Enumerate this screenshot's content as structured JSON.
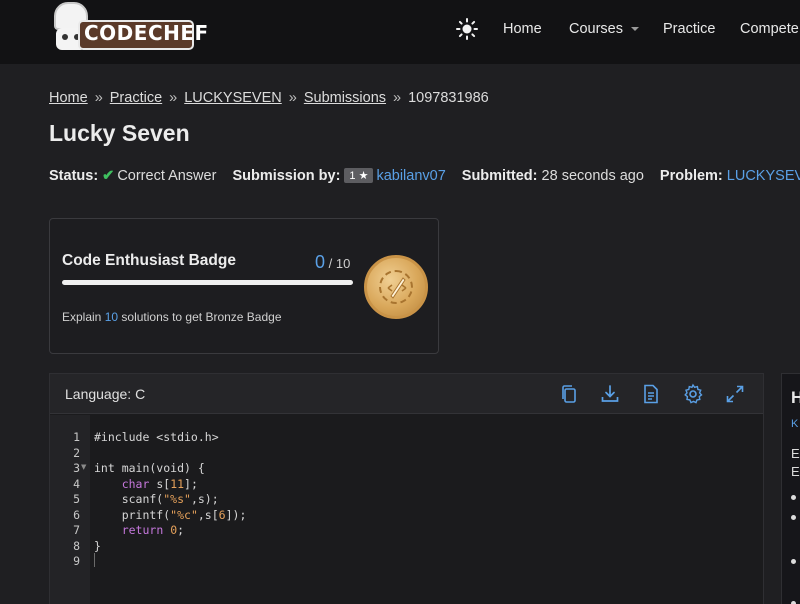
{
  "brand": {
    "logo_text": "CODECHEF"
  },
  "nav": {
    "home": "Home",
    "courses": "Courses",
    "practice": "Practice",
    "compete": "Compete"
  },
  "breadcrumb": {
    "home": "Home",
    "practice": "Practice",
    "problem": "LUCKYSEVEN",
    "submissions": "Submissions",
    "sep": "»",
    "id": "1097831986"
  },
  "page": {
    "title": "Lucky Seven"
  },
  "status": {
    "status_label": "Status:",
    "status_value": "Correct Answer",
    "by_label": "Submission by:",
    "rating": "1 ★",
    "user": "kabilanv07",
    "submitted_label": "Submitted:",
    "submitted_value": "28 seconds ago",
    "problem_label": "Problem:",
    "problem_value": "LUCKYSEVEN"
  },
  "badge": {
    "title": "Code Enthusiast Badge",
    "current": "0",
    "total": "/ 10",
    "progress": 0,
    "hint_pre": "Explain ",
    "hint_num": "10",
    "hint_post": " solutions to get Bronze Badge"
  },
  "code": {
    "language_label": "Language: C",
    "line_numbers": [
      "1",
      "2",
      "3",
      "4",
      "5",
      "6",
      "7",
      "8",
      "9"
    ],
    "lines": [
      "#include <stdio.h>",
      "",
      "int main(void) {",
      "    char s[11];",
      "    scanf(\"%s\",s);",
      "    printf(\"%c\",s[6]);",
      "    return 0;",
      "}",
      ""
    ]
  },
  "side": {
    "heading": "H",
    "k": "K",
    "e1": "E",
    "e2": "E"
  },
  "colors": {
    "accent": "#5aa0e6",
    "success": "#3fbf5f",
    "bg": "#1f1f22",
    "nav_bg": "#121214"
  }
}
